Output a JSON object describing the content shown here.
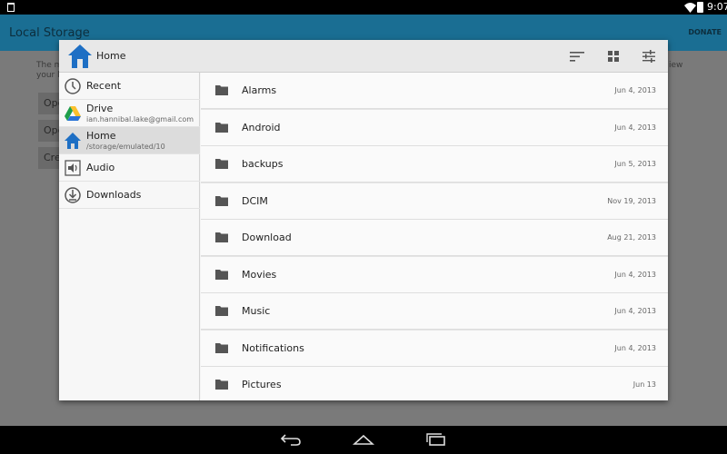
{
  "status_bar": {
    "time": "9:07"
  },
  "background_app": {
    "title": "Local Storage",
    "donate": "DONATE",
    "partial_text_1": "The m",
    "partial_text_2": "your l",
    "partial_text_right": "iew",
    "buttons": [
      "Ope",
      "Ope",
      "Cre"
    ]
  },
  "dialog": {
    "title": "Home",
    "toolbar": {
      "sort_icon": "sort-icon",
      "grid_icon": "grid-view-icon",
      "settings_icon": "settings-sliders-icon"
    },
    "sidebar": [
      {
        "label": "Recent",
        "icon": "clock-icon"
      },
      {
        "label": "Drive",
        "sub": "ian.hannibal.lake@gmail.com",
        "icon": "drive-icon"
      },
      {
        "label": "Home",
        "sub": "/storage/emulated/10",
        "icon": "home-icon",
        "active": true
      },
      {
        "label": "Audio",
        "icon": "audio-icon"
      },
      {
        "label": "Downloads",
        "icon": "download-icon"
      }
    ],
    "files": [
      {
        "name": "Alarms",
        "date": "Jun 4, 2013"
      },
      {
        "name": "Android",
        "date": "Jun 4, 2013"
      },
      {
        "name": "backups",
        "date": "Jun 5, 2013"
      },
      {
        "name": "DCIM",
        "date": "Nov 19, 2013"
      },
      {
        "name": "Download",
        "date": "Aug 21, 2013"
      },
      {
        "name": "Movies",
        "date": "Jun 4, 2013"
      },
      {
        "name": "Music",
        "date": "Jun 4, 2013"
      },
      {
        "name": "Notifications",
        "date": "Jun 4, 2013"
      },
      {
        "name": "Pictures",
        "date": "Jun 13"
      }
    ]
  },
  "colors": {
    "accent": "#1a6e93",
    "home_blue": "#1e6fc4"
  }
}
